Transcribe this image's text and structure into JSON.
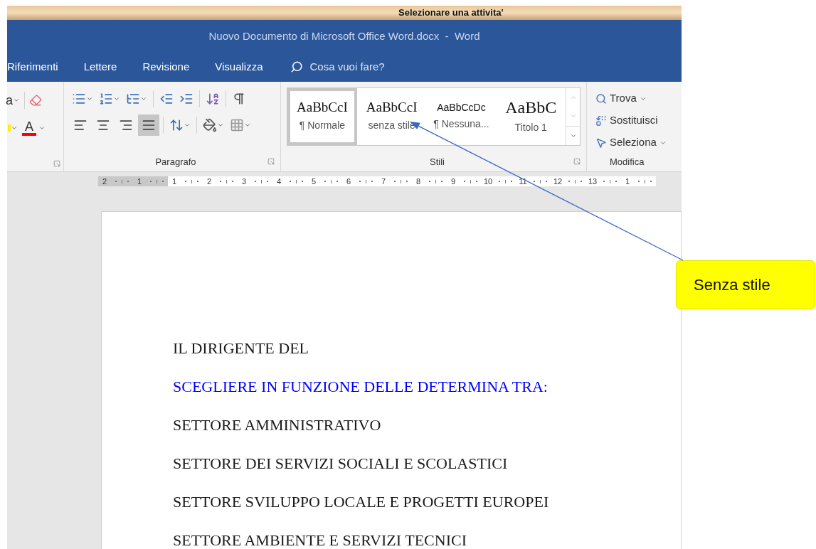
{
  "app_bar": {
    "title": "Selezionare una attivita'"
  },
  "window": {
    "title": "Nuovo Documento di Microsoft Office Word.docx  -  Word"
  },
  "tabs": [
    {
      "label": "Riferimenti",
      "selected": false
    },
    {
      "label": "Lettere",
      "selected": false
    },
    {
      "label": "Revisione",
      "selected": false
    },
    {
      "label": "Visualizza",
      "selected": false
    }
  ],
  "tell_me": {
    "placeholder": "Cosa vuoi fare?"
  },
  "ribbon": {
    "font_group": {
      "case_button": "a",
      "font_color_button": "A"
    },
    "paragraph_group": {
      "label": "Paragrafo",
      "alignments": [
        {
          "kind": "left",
          "selected": false
        },
        {
          "kind": "center",
          "selected": false
        },
        {
          "kind": "right",
          "selected": false
        },
        {
          "kind": "justify",
          "selected": true
        }
      ]
    },
    "styles_group": {
      "label": "Stili",
      "styles": [
        {
          "preview": "AaBbCcI",
          "name": "¶ Normale",
          "kind": "serif",
          "selected": true
        },
        {
          "preview": "AaBbCcI",
          "name": "senza stile",
          "kind": "serif",
          "selected": false
        },
        {
          "preview": "AaBbCcDc",
          "name": "¶ Nessuna...",
          "kind": "sans",
          "selected": false
        },
        {
          "preview": "AaBbC",
          "name": "Titolo 1",
          "kind": "heading",
          "selected": false
        }
      ]
    },
    "editing_group": {
      "label": "Modifica",
      "commands": [
        {
          "kind": "find",
          "label": "Trova"
        },
        {
          "kind": "replace",
          "label": "Sostituisci"
        },
        {
          "kind": "select",
          "label": "Seleziona"
        }
      ]
    }
  },
  "ruler": [
    "2",
    "1",
    "1",
    "2",
    "3",
    "4",
    "5",
    "6",
    "7",
    "8",
    "9",
    "10",
    "11",
    "12",
    "13",
    "1"
  ],
  "document": {
    "lines": [
      {
        "text": "IL DIRIGENTE DEL",
        "color": "#1a1a1a"
      },
      {
        "text": "SCEGLIERE IN FUNZIONE DELLE DETERMINA TRA:",
        "color": "#0000ff"
      },
      {
        "text": "SETTORE AMMINISTRATIVO",
        "color": "#1a1a1a"
      },
      {
        "text": "SETTORE DEI SERVIZI SOCIALI E SCOLASTICI",
        "color": "#1a1a1a"
      },
      {
        "text": "SETTORE SVILUPPO LOCALE E PROGETTI EUROPEI",
        "color": "#1a1a1a"
      },
      {
        "text": "SETTORE AMBIENTE E SERVIZI TECNICI",
        "color": "#1a1a1a"
      }
    ]
  },
  "callout": {
    "text": "Senza stile"
  }
}
